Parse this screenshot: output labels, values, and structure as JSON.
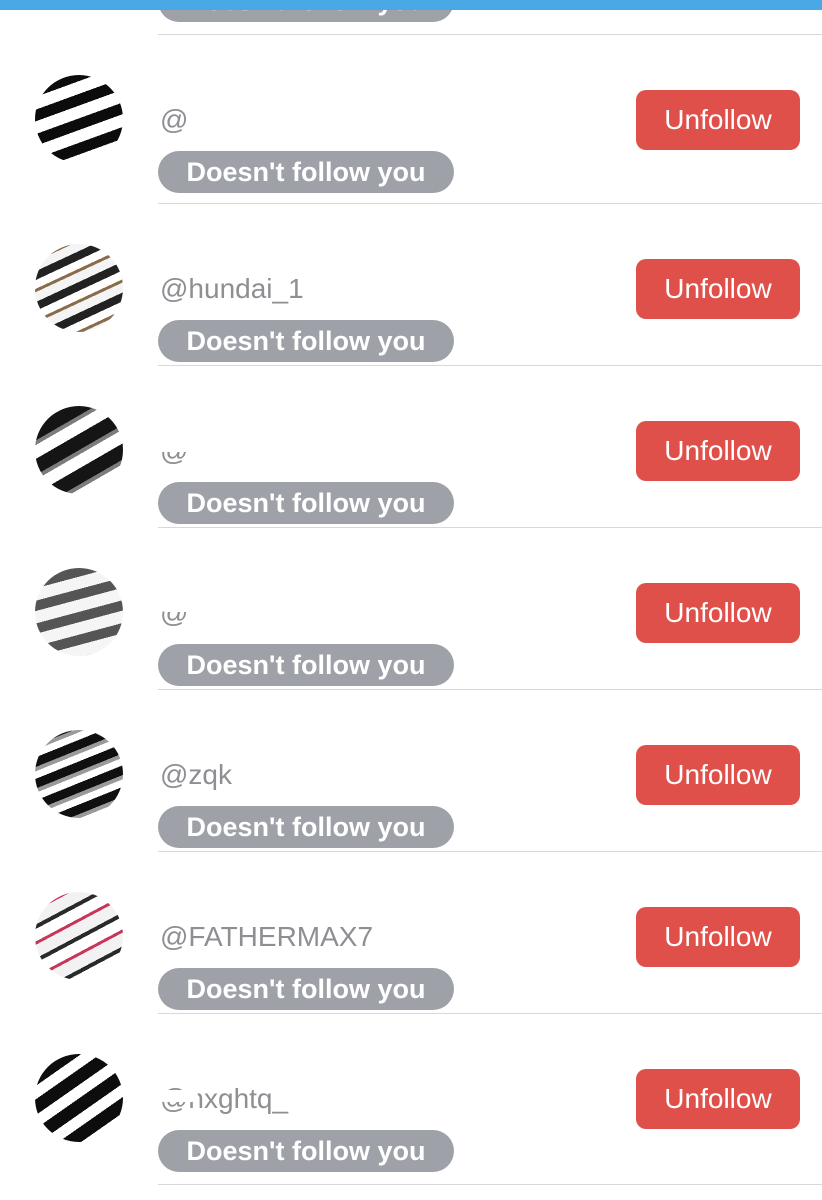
{
  "badge_label": "Doesn't follow you",
  "unfollow_label": "Unfollow",
  "users": [
    {
      "name": "",
      "handle": "@"
    },
    {
      "name": "",
      "handle": "@hundai_1"
    },
    {
      "name": "",
      "handle": "@"
    },
    {
      "name": "",
      "handle": "@"
    },
    {
      "name": "",
      "handle": "@zqk"
    },
    {
      "name": "",
      "handle": "@FATHERMAX7"
    },
    {
      "name": "",
      "handle": "@nxghtq_"
    }
  ],
  "colors": {
    "top_bar": "#4aa8e6",
    "unfollow_button": "#e0504a",
    "badge": "#9ea1a8",
    "handle_text": "#8e8e93"
  }
}
